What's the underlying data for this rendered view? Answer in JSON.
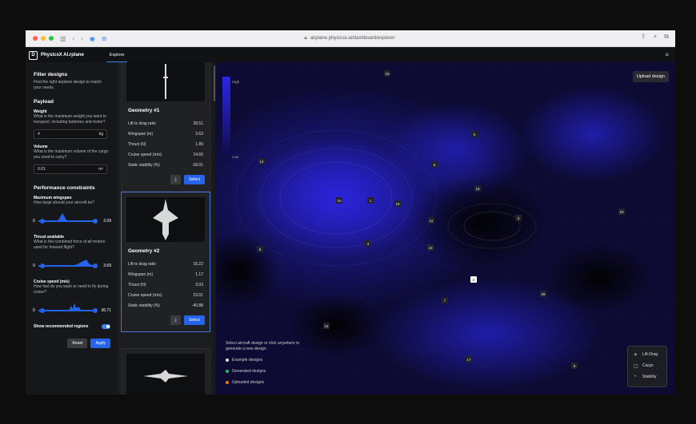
{
  "browser": {
    "url": "airplane.physicsx.ai/dashboard/explorer"
  },
  "app": {
    "brand": "PhysicsX AI.rplane",
    "nav_tab": "Explore"
  },
  "filters": {
    "title": "Filter designs",
    "subtitle": "Find the right airplane design to match your needs.",
    "payload_heading": "Payload",
    "weight_label": "Weight",
    "weight_help": "What is the maximum weight you want to transport, including batteries and motor?",
    "weight_value": "4",
    "weight_unit": "kg",
    "volume_label": "Volume",
    "volume_help": "What is the maximum volume of the cargo you need to carry?",
    "volume_value": "0.01",
    "volume_unit": "m³",
    "perf_heading": "Performance constraints",
    "wingspan_label": "Maximum wingspan",
    "wingspan_help": "How large should your aircraft be?",
    "wingspan_min": "0",
    "wingspan_max": "2.09",
    "thrust_label": "Thrust available",
    "thrust_help": "What is the combined force of all motors used for forward flight?",
    "thrust_min": "0",
    "thrust_max": "3.69",
    "cruise_label": "Cruise speed (m/s)",
    "cruise_help": "How fast do you want or need to fly during cruise?",
    "cruise_min": "0",
    "cruise_max": "36.71",
    "toggle_label": "Show recommended regions",
    "reset_label": "Reset",
    "apply_label": "Apply"
  },
  "cards": [
    {
      "title": "Geometry #1",
      "rows": [
        {
          "k": "Lift to drag ratio",
          "v": "28.51"
        },
        {
          "k": "Wingspan (m)",
          "v": "3.63"
        },
        {
          "k": "Thrust (N)",
          "v": "1.89"
        },
        {
          "k": "Cruise speed (m/s)",
          "v": "14.65"
        },
        {
          "k": "Static stability (%)",
          "v": "-18.01"
        }
      ],
      "select_label": "Select"
    },
    {
      "title": "Geometry #2",
      "rows": [
        {
          "k": "Lift to drag ratio",
          "v": "16.22"
        },
        {
          "k": "Wingspan (m)",
          "v": "1.17"
        },
        {
          "k": "Thrust (N)",
          "v": "3.03"
        },
        {
          "k": "Cruise speed (m/s)",
          "v": "23.01"
        },
        {
          "k": "Static stability (%)",
          "v": "-40.88"
        }
      ],
      "select_label": "Select"
    }
  ],
  "map": {
    "legend_high": "High",
    "legend_low": "Low",
    "upload_label": "Upload design",
    "hint": "Select aircraft design or click anywhere to generate a new design.",
    "legend_items": [
      {
        "label": "Example designs",
        "color": "#e5e5e5"
      },
      {
        "label": "Generated designs",
        "color": "#22c55e"
      },
      {
        "label": "Uploaded designs",
        "color": "#f97316"
      }
    ],
    "metrics": [
      "Lift-Drag",
      "Cargo",
      "Stability"
    ],
    "markers": [
      "15",
      "5",
      "12",
      "6",
      "16",
      "19",
      "1",
      "18",
      "11",
      "3",
      "10",
      "4",
      "13",
      "9",
      "2",
      "7",
      "28",
      "14",
      "17",
      "8"
    ]
  }
}
